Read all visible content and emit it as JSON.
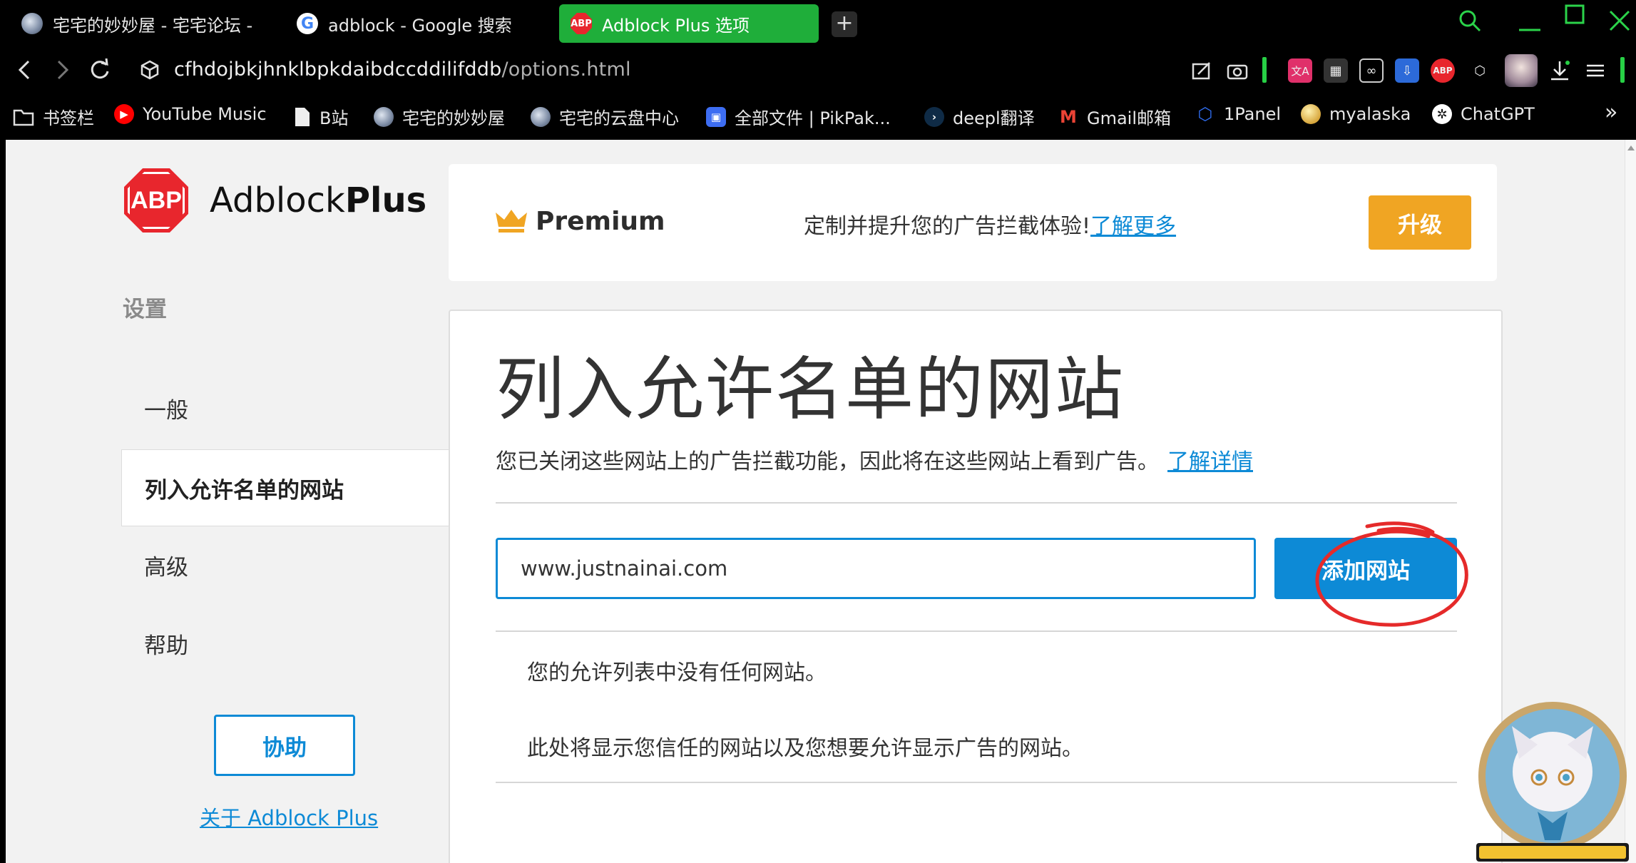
{
  "browser": {
    "tabs": [
      {
        "title": "宅宅的妙妙屋 - 宅宅论坛 - ",
        "favicon": "anime-avatar-icon"
      },
      {
        "title": "adblock - Google 搜索",
        "favicon": "google-icon"
      },
      {
        "title": "Adblock Plus 选项",
        "favicon": "abp-icon",
        "active": true
      }
    ],
    "newtab_label": "+",
    "url_host": "cfhdojbkjhnklbpkdaibdccddilifddb",
    "url_path": "/options.html",
    "bookmarks": [
      {
        "label": "书签栏",
        "icon": "folder-icon"
      },
      {
        "label": "YouTube Music",
        "icon": "youtube-music-icon"
      },
      {
        "label": "B站",
        "icon": "document-icon"
      },
      {
        "label": "宅宅的妙妙屋",
        "icon": "anime-avatar-icon"
      },
      {
        "label": "宅宅的云盘中心",
        "icon": "anime-avatar-icon"
      },
      {
        "label": "全部文件 | PikPak...",
        "icon": "pikpak-icon"
      },
      {
        "label": "deepl翻译",
        "icon": "deepl-icon"
      },
      {
        "label": "Gmail邮箱",
        "icon": "gmail-icon"
      },
      {
        "label": "1Panel",
        "icon": "1panel-icon"
      },
      {
        "label": "myalaska",
        "icon": "globe-icon"
      },
      {
        "label": "ChatGPT",
        "icon": "chatgpt-icon"
      }
    ],
    "more_bookmarks": "»",
    "accent": "#1fae3a"
  },
  "logo": {
    "abp": "ABP",
    "name_light": "Adblock",
    "name_bold": "Plus"
  },
  "sidebar": {
    "heading": "设置",
    "items": [
      {
        "label": "一般"
      },
      {
        "label": "列入允许名单的网站",
        "active": true
      },
      {
        "label": "高级"
      },
      {
        "label": "帮助"
      }
    ],
    "help_button": "协助",
    "about_link": "关于 Adblock Plus"
  },
  "premium": {
    "title": "Premium",
    "text": "定制并提升您的广告拦截体验!",
    "link": "了解更多",
    "upgrade": "升级",
    "upgrade_color": "#f0a523"
  },
  "main": {
    "title": "列入允许名单的网站",
    "description": "您已关闭这些网站上的广告拦截功能，因此将在这些网站上看到广告。",
    "description_link": "了解详情",
    "input_value": "www.justnainai.com",
    "add_button": "添加网站",
    "empty_line1": "您的允许列表中没有任何网站。",
    "empty_line2": "此处将显示您信任的网站以及您想要允许显示广告的网站。",
    "accent": "#0d8ad6"
  }
}
